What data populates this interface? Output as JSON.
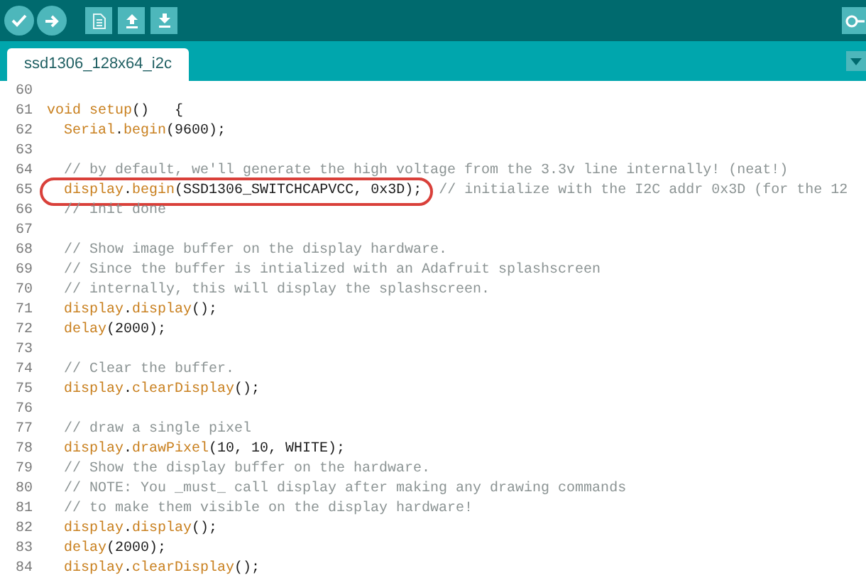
{
  "toolbar": {
    "buttons": [
      {
        "kind": "verify"
      },
      {
        "kind": "upload"
      },
      {
        "kind": "new"
      },
      {
        "kind": "open"
      },
      {
        "kind": "save"
      }
    ]
  },
  "tabs": [
    {
      "label": "ssd1306_128x64_i2c",
      "selected": true
    }
  ],
  "editor": {
    "lines": [
      {
        "number": "60"
      },
      {
        "number": "61",
        "tokens": [
          {
            "text": "void",
            "kind": "keyword"
          },
          {
            "text": "setup",
            "kind": "keyword"
          },
          {
            "text": "()   {",
            "kind": "plain"
          }
        ],
        "children": [
          {
            "number": "62",
            "tokens": [
              {
                "text": "Serial",
                "kind": "keyword"
              },
              {
                "text": ".",
                "kind": "plain"
              },
              {
                "text": "begin",
                "kind": "keyword"
              },
              {
                "text": "(9600);",
                "kind": "plain"
              }
            ]
          },
          {
            "number": "63"
          },
          {
            "number": "64",
            "tokens": [
              {
                "text": "// by default, we'll generate the high voltage from the 3.3v line internally! (neat!)",
                "kind": "comment"
              }
            ]
          },
          {
            "number": "65",
            "circled": true,
            "tokens": [
              {
                "text": "display",
                "kind": "keyword"
              },
              {
                "text": ".",
                "kind": "plain"
              },
              {
                "text": "begin",
                "kind": "keyword"
              },
              {
                "text": "(SSD1306_SWITCHCAPVCC, 0x3D);",
                "kind": "plain"
              }
            ],
            "comment": "// initialize with the I2C addr 0x3D (for the 12"
          },
          {
            "number": "66",
            "tokens": [
              {
                "text": "// init done",
                "kind": "comment"
              }
            ]
          },
          {
            "number": "67"
          },
          {
            "number": "68",
            "tokens": [
              {
                "text": "// Show image buffer on the display hardware.",
                "kind": "comment"
              }
            ]
          },
          {
            "number": "69",
            "tokens": [
              {
                "text": "// Since the buffer is intialized with an Adafruit splashscreen",
                "kind": "comment"
              }
            ]
          },
          {
            "number": "70",
            "tokens": [
              {
                "text": "// internally, this will display the splashscreen.",
                "kind": "comment"
              }
            ]
          },
          {
            "number": "71",
            "tokens": [
              {
                "text": "display",
                "kind": "keyword"
              },
              {
                "text": ".",
                "kind": "plain"
              },
              {
                "text": "display",
                "kind": "keyword"
              },
              {
                "text": "();",
                "kind": "plain"
              }
            ]
          },
          {
            "number": "72",
            "tokens": [
              {
                "text": "delay",
                "kind": "keyword"
              },
              {
                "text": "(2000);",
                "kind": "plain"
              }
            ]
          },
          {
            "number": "73"
          },
          {
            "number": "74",
            "tokens": [
              {
                "text": "// Clear the buffer.",
                "kind": "comment"
              }
            ]
          },
          {
            "number": "75",
            "tokens": [
              {
                "text": "display",
                "kind": "keyword"
              },
              {
                "text": ".",
                "kind": "plain"
              },
              {
                "text": "clearDisplay",
                "kind": "keyword"
              },
              {
                "text": "();",
                "kind": "plain"
              }
            ]
          },
          {
            "number": "76"
          },
          {
            "number": "77",
            "tokens": [
              {
                "text": "// draw a single pixel",
                "kind": "comment"
              }
            ]
          },
          {
            "number": "78",
            "tokens": [
              {
                "text": "display",
                "kind": "keyword"
              },
              {
                "text": ".",
                "kind": "plain"
              },
              {
                "text": "drawPixel",
                "kind": "keyword"
              },
              {
                "text": "(10, 10, WHITE);",
                "kind": "plain"
              }
            ]
          },
          {
            "number": "79",
            "tokens": [
              {
                "text": "// Show the display buffer on the hardware.",
                "kind": "comment"
              }
            ]
          },
          {
            "number": "80",
            "tokens": [
              {
                "text": "// NOTE: You _must_ call display after making any drawing commands",
                "kind": "comment"
              }
            ]
          },
          {
            "number": "81",
            "tokens": [
              {
                "text": "// to make them visible on the display hardware!",
                "kind": "comment"
              }
            ]
          },
          {
            "number": "82",
            "tokens": [
              {
                "text": "display",
                "kind": "keyword"
              },
              {
                "text": ".",
                "kind": "plain"
              },
              {
                "text": "display",
                "kind": "keyword"
              },
              {
                "text": "();",
                "kind": "plain"
              }
            ]
          },
          {
            "number": "83",
            "tokens": [
              {
                "text": "delay",
                "kind": "keyword"
              },
              {
                "text": "(2000);",
                "kind": "plain"
              }
            ]
          },
          {
            "number": "84",
            "tokens": [
              {
                "text": "display",
                "kind": "keyword"
              },
              {
                "text": ".",
                "kind": "plain"
              },
              {
                "text": "clearDisplay",
                "kind": "keyword"
              },
              {
                "text": "();",
                "kind": "plain"
              }
            ]
          }
        ]
      }
    ]
  }
}
